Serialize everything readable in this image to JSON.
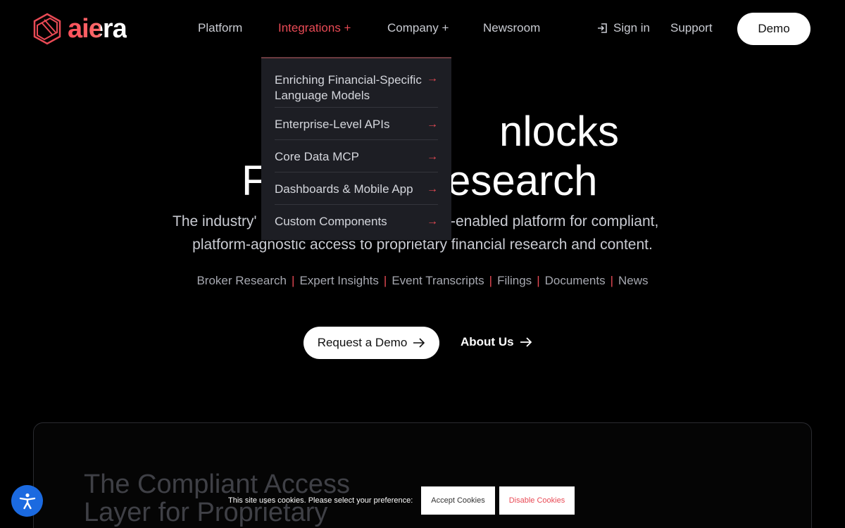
{
  "brand": {
    "name": "aiera",
    "accent": "#e94a55"
  },
  "nav": {
    "items": [
      {
        "label": "Platform"
      },
      {
        "label": "Integrations +"
      },
      {
        "label": "Company +"
      },
      {
        "label": "Newsroom"
      }
    ],
    "signin": "Sign in",
    "support": "Support",
    "demo": "Demo"
  },
  "dropdown": {
    "items": [
      {
        "label": "Enriching Financial-Specific Language Models"
      },
      {
        "label": "Enterprise-Level APIs"
      },
      {
        "label": "Core Data MCP"
      },
      {
        "label": "Dashboards & Mobile App"
      },
      {
        "label": "Custom Components"
      }
    ]
  },
  "hero": {
    "line1": "nlocks",
    "line2_left": "F",
    "line2_right": "esearch",
    "sub_left_1": "The industry'",
    "sub_right_1": "-enabled platform for compliant,",
    "sub_2": "platform-agnostic access to proprietary financial research and content.",
    "categories": [
      "Broker Research",
      "Expert Insights",
      "Event Transcripts",
      "Filings",
      "Documents",
      "News"
    ],
    "cta_primary": "Request a Demo",
    "cta_secondary": "About Us"
  },
  "card": {
    "title_line1": "The Compliant Access",
    "title_line2": "Layer for Proprietary"
  },
  "cookie": {
    "text": "This site uses cookies. Please select your preference:",
    "accept": "Accept Cookies",
    "disable": "Disable Cookies"
  }
}
